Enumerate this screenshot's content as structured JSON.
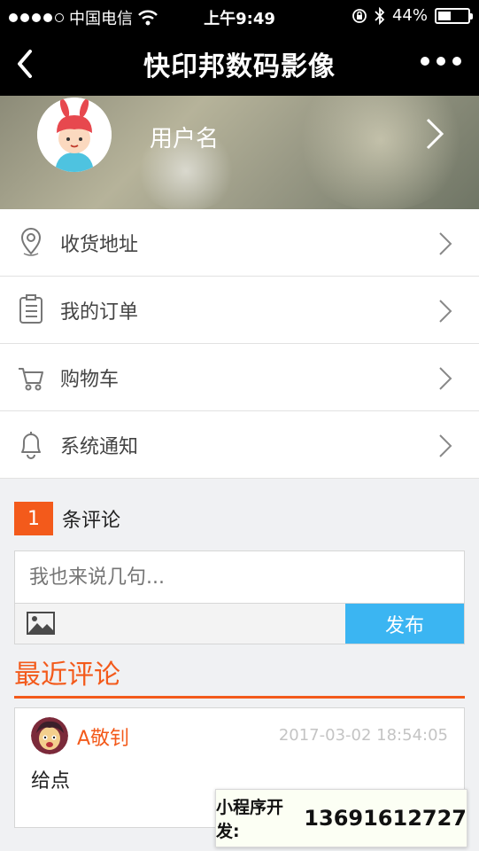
{
  "status_bar": {
    "carrier": "中国电信",
    "time": "上午9:49",
    "battery_percent": "44%",
    "battery_level": 0.44
  },
  "nav": {
    "title": "快印邦数码影像"
  },
  "profile": {
    "username": "用户名"
  },
  "menu": [
    {
      "label": "收货地址",
      "icon": "location-pin-icon"
    },
    {
      "label": "我的订单",
      "icon": "clipboard-icon"
    },
    {
      "label": "购物车",
      "icon": "cart-icon"
    },
    {
      "label": "系统通知",
      "icon": "bell-icon"
    }
  ],
  "comments": {
    "count": "1",
    "count_label": "条评论",
    "input_placeholder": "我也来说几句...",
    "publish_label": "发布",
    "recent_title": "最近评论",
    "items": [
      {
        "author": "A敬钊",
        "time": "2017-03-02 18:54:05",
        "text": "给点"
      }
    ]
  },
  "dev_badge": {
    "label": "小程序开发:",
    "phone": "13691612727"
  },
  "colors": {
    "accent": "#f35a1b",
    "publish": "#3bb5f2",
    "navbar": "#000000"
  }
}
